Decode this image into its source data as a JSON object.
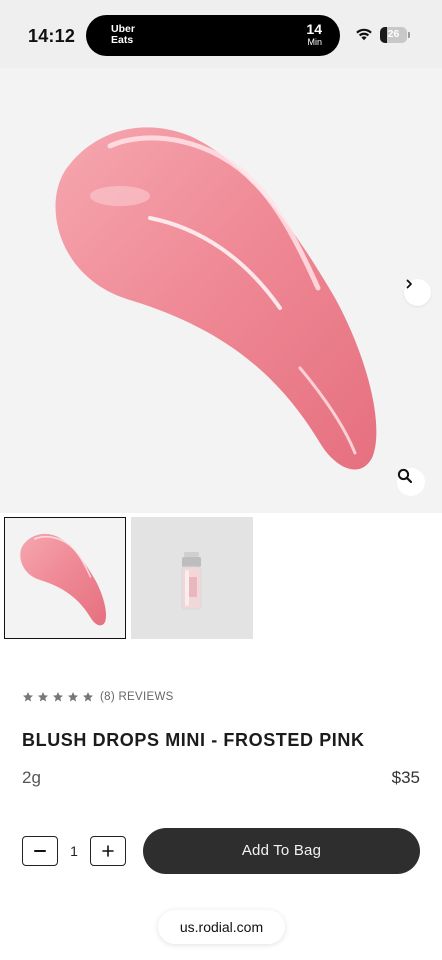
{
  "status_bar": {
    "time": "14:12",
    "live_activity": {
      "brand": "Uber Eats",
      "eta_value": "14",
      "eta_unit": "Min"
    },
    "battery_level": "26"
  },
  "gallery": {
    "next_icon": "chevron-right-icon",
    "zoom_icon": "magnifier-icon",
    "swatch_color": "#f08a95",
    "thumbnails": [
      "swatch",
      "bottle"
    ]
  },
  "product": {
    "rating_stars": 5,
    "reviews_label": "(8) REVIEWS",
    "title": "BLUSH DROPS MINI - FROSTED PINK",
    "variant": "2g",
    "price": "$35"
  },
  "purchase": {
    "quantity": "1",
    "add_to_bag_label": "Add To Bag"
  },
  "browser": {
    "url": "us.rodial.com"
  }
}
